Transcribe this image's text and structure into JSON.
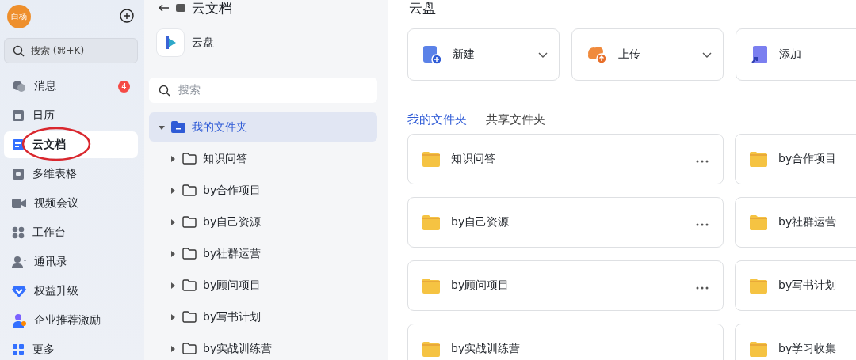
{
  "sidebar": {
    "avatar": "白杨",
    "search": {
      "placeholder": "搜索 (⌘+K)"
    },
    "items": [
      {
        "label": "消息",
        "badge": "4",
        "selected": false,
        "circled": false
      },
      {
        "label": "日历",
        "selected": false,
        "circled": false
      },
      {
        "label": "云文档",
        "selected": true,
        "circled": true
      },
      {
        "label": "多维表格",
        "selected": false,
        "circled": false
      },
      {
        "label": "视频会议",
        "selected": false,
        "circled": false
      },
      {
        "label": "工作台",
        "selected": false,
        "circled": false
      },
      {
        "label": "通讯录",
        "selected": false,
        "circled": false
      },
      {
        "label": "权益升级",
        "selected": false,
        "circled": false
      },
      {
        "label": "企业推荐激励",
        "selected": false,
        "circled": false
      },
      {
        "label": "更多",
        "selected": false,
        "circled": false
      }
    ]
  },
  "docs_panel": {
    "title": "云文档",
    "drive": "云盘",
    "search": {
      "placeholder": "搜索"
    },
    "tree": [
      {
        "label": "我的文件夹",
        "expanded": true,
        "selected": true,
        "children": [
          {
            "label": "知识问答",
            "expanded": false,
            "selected": false
          },
          {
            "label": "by合作项目",
            "expanded": false,
            "selected": false
          },
          {
            "label": "by自己资源",
            "expanded": false,
            "selected": false
          },
          {
            "label": "by社群运营",
            "expanded": false,
            "selected": false
          },
          {
            "label": "by顾问项目",
            "expanded": false,
            "selected": false
          },
          {
            "label": "by写书计划",
            "expanded": false,
            "selected": false
          },
          {
            "label": "by实战训练营",
            "expanded": false,
            "selected": false
          }
        ]
      }
    ]
  },
  "main": {
    "title": "云盘",
    "actions": [
      {
        "label": "新建",
        "kind": "new",
        "dropdown": true
      },
      {
        "label": "上传",
        "kind": "upload",
        "dropdown": true
      },
      {
        "label": "添加",
        "kind": "add"
      }
    ],
    "tabs": [
      {
        "label": "我的文件夹",
        "selected": true
      },
      {
        "label": "共享文件夹",
        "selected": false
      }
    ],
    "folders": [
      {
        "label": "知识问答",
        "menu": true
      },
      {
        "label": "by合作项目"
      },
      {
        "label": "by自己资源",
        "menu": true
      },
      {
        "label": "by社群运营"
      },
      {
        "label": "by顾问项目",
        "menu": true
      },
      {
        "label": "by写书计划"
      },
      {
        "label": "by实战训练营",
        "menu": false
      },
      {
        "label": "by学习收集"
      }
    ]
  }
}
